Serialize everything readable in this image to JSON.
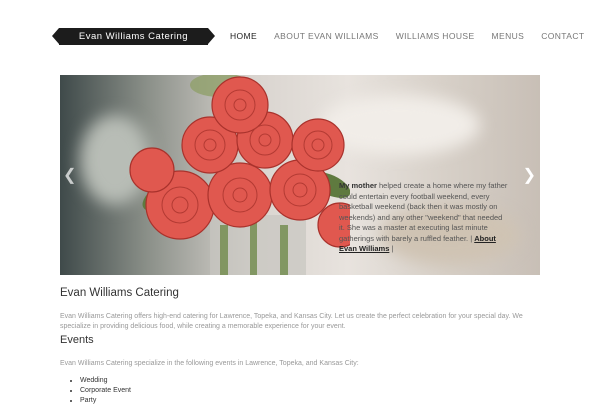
{
  "header": {
    "logo_text": "Evan Williams Catering",
    "nav": [
      {
        "label": "HOME",
        "active": true
      },
      {
        "label": "ABOUT EVAN WILLIAMS",
        "active": false
      },
      {
        "label": "WILLIAMS HOUSE",
        "active": false
      },
      {
        "label": "MENUS",
        "active": false
      },
      {
        "label": "CONTACT",
        "active": false
      }
    ]
  },
  "slider": {
    "image": "red-roses-centerpiece-on-table",
    "caption_bold": "My mother",
    "caption_text": " helped create a home where my father could entertain every football weekend, every basketball weekend (back then it was mostly on weekends) and any other \"weekend\" that needed it. She was a master at executing last minute gatherings with barely a ruffled feather. | ",
    "caption_link": "About Evan Williams",
    "caption_end": " |",
    "prev_icon": "chevron-left-icon",
    "next_icon": "chevron-right-icon"
  },
  "main": {
    "title": "Evan Williams Catering",
    "intro": "Evan Williams Catering offers high-end catering for Lawrence, Topeka, and Kansas City. Let us create the perfect celebration for your special day. We specialize in providing delicious food, while creating a memorable experience for your event.",
    "events_heading": "Events",
    "events_intro": "Evan Williams Catering specialize in the following events in Lawrence, Topeka, and Kansas City:",
    "events": [
      "Wedding",
      "Corporate Event",
      "Party"
    ]
  },
  "colors": {
    "logo_bg": "#1c1c1c",
    "nav_text": "#777777",
    "nav_active": "#222222",
    "body_text": "#999999",
    "rose": "#e0584f"
  }
}
